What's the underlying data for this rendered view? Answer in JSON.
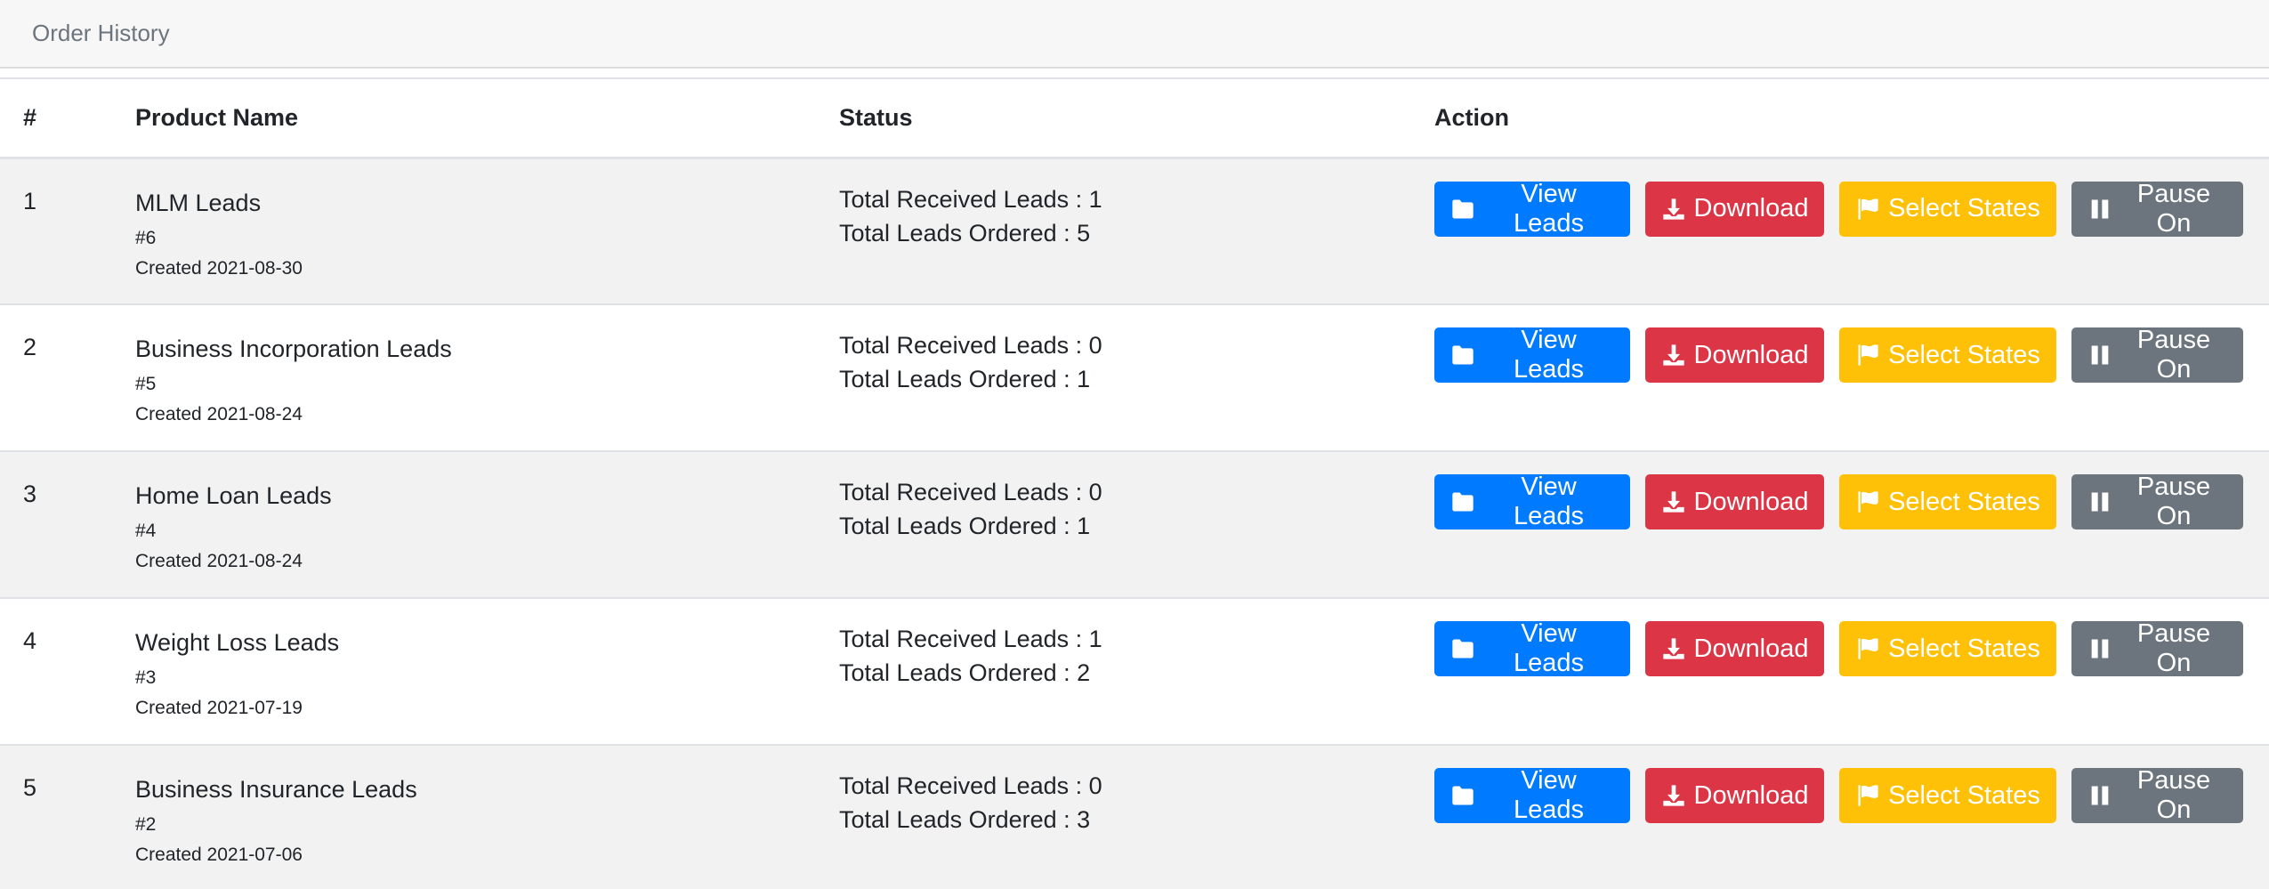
{
  "card": {
    "title": "Order History"
  },
  "table": {
    "headers": {
      "num": "#",
      "product": "Product Name",
      "status": "Status",
      "action": "Action"
    },
    "rows": [
      {
        "num": "1",
        "name": "MLM Leads",
        "id": "#6",
        "created": "Created 2021-08-30",
        "received": "Total Received Leads : 1",
        "ordered": "Total Leads Ordered : 5"
      },
      {
        "num": "2",
        "name": "Business Incorporation Leads",
        "id": "#5",
        "created": "Created 2021-08-24",
        "received": "Total Received Leads : 0",
        "ordered": "Total Leads Ordered : 1"
      },
      {
        "num": "3",
        "name": "Home Loan Leads",
        "id": "#4",
        "created": "Created 2021-08-24",
        "received": "Total Received Leads : 0",
        "ordered": "Total Leads Ordered : 1"
      },
      {
        "num": "4",
        "name": "Weight Loss Leads",
        "id": "#3",
        "created": "Created 2021-07-19",
        "received": "Total Received Leads : 1",
        "ordered": "Total Leads Ordered : 2"
      },
      {
        "num": "5",
        "name": "Business Insurance Leads",
        "id": "#2",
        "created": "Created 2021-07-06",
        "received": "Total Received Leads : 0",
        "ordered": "Total Leads Ordered : 3"
      }
    ]
  },
  "buttons": {
    "view_leads": {
      "label": "View Leads",
      "icon": "folder-icon",
      "color": "#007bff"
    },
    "download": {
      "label": "Download",
      "icon": "download-icon",
      "color": "#dc3545"
    },
    "select_states": {
      "label": "Select States",
      "icon": "flag-icon",
      "color": "#ffc107"
    },
    "pause_on": {
      "label": "Pause On",
      "icon": "pause-icon",
      "color": "#6c757d"
    }
  }
}
